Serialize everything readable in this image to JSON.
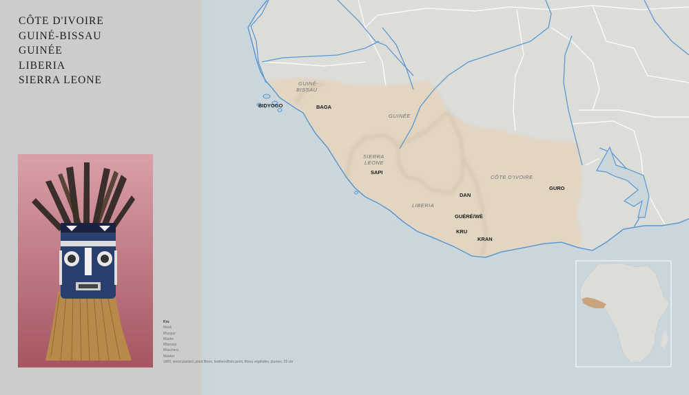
{
  "countries": [
    "CÔTE D'IVOIRE",
    "GUINÉ-BISSAU",
    "GUINÉE",
    "LIBERIA",
    "SIERRA LEONE"
  ],
  "caption": {
    "name": "Kru",
    "lines": [
      "Mask",
      "Masque",
      "Maske",
      "Máscara",
      "Maschera",
      "Masker"
    ],
    "note": "1805, wood painted, plant fibres, feathers/Bois peint, fibres végétales, plumes, 29 cm"
  },
  "map": {
    "region_labels": {
      "guine_bissau_1": "GUINÉ-",
      "guine_bissau_2": "BISSAU",
      "guinee": "GUINÉE",
      "sierra_leone_1": "SIERRA",
      "sierra_leone_2": "LEONE",
      "liberia": "LIBERIA",
      "cote_divoire": "CÔTE D'IVOIRE"
    },
    "ethnic_labels": {
      "bidyogo": "BIDYOGO",
      "baga": "BAGA",
      "sapi": "SAPI",
      "dan": "DAN",
      "guro": "GURO",
      "guere_we": "GUÉRÉ/WÈ",
      "kru": "KRU",
      "kran": "KRAN"
    },
    "colors": {
      "ocean": "#c9d7dd",
      "land": "#dcdcd9",
      "highlight": "#e2d5c2",
      "rivers": "#5b97cf",
      "borders": "#ffffff"
    }
  },
  "inset": {
    "label": "Africa locator",
    "colors": {
      "land": "#dcdcd9",
      "highlight": "#c9a27e"
    }
  }
}
